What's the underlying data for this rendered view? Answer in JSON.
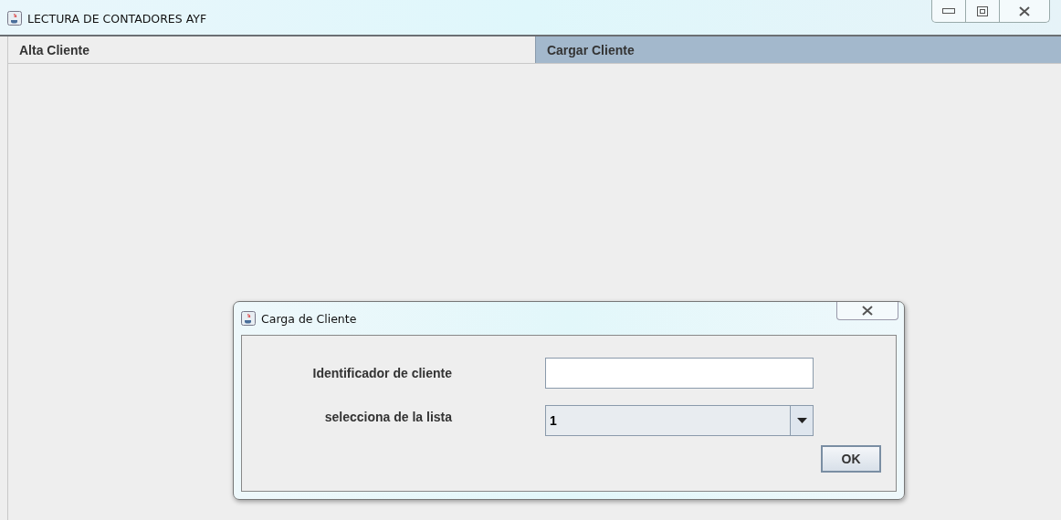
{
  "window": {
    "title": "LECTURA DE CONTADORES AYF"
  },
  "tabs": [
    {
      "label": "Alta Cliente",
      "selected": false
    },
    {
      "label": "Cargar Cliente",
      "selected": true
    }
  ],
  "dialog": {
    "title": "Carga de Cliente",
    "fields": [
      {
        "kind": "text",
        "label": "Identificador de cliente"
      },
      {
        "kind": "combo",
        "label": "selecciona de la lista",
        "value": "1"
      }
    ],
    "button": "OK"
  }
}
